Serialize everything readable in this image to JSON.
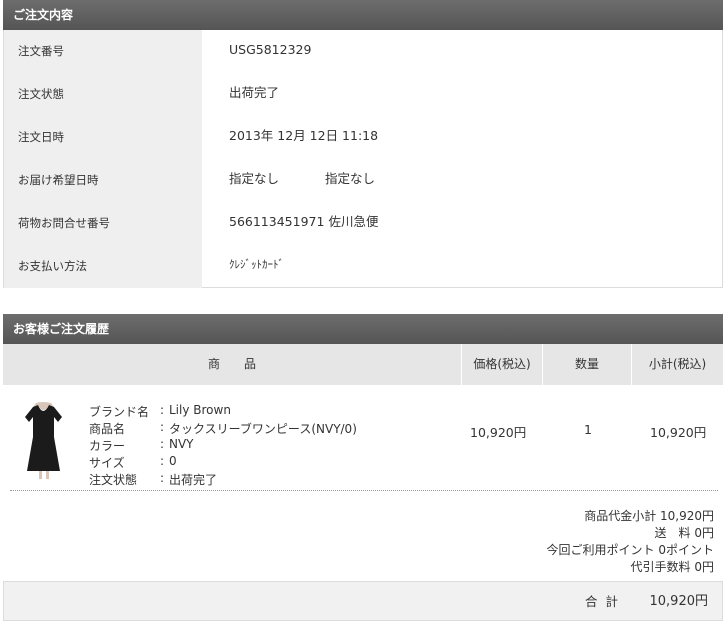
{
  "order_section": {
    "title": "ご注文内容",
    "rows": [
      {
        "label": "注文番号",
        "value": "USG5812329"
      },
      {
        "label": "注文状態",
        "value": "出荷完了"
      },
      {
        "label": "注文日時",
        "value": "2013年 12月 12日 11:18"
      },
      {
        "label": "お届け希望日時",
        "value": "指定なし",
        "value2": "指定なし"
      },
      {
        "label": "荷物お問合せ番号",
        "value": "566113451971",
        "value2": "佐川急便"
      },
      {
        "label": "お支払い方法",
        "value": "ｸﾚｼﾞｯﾄｶｰﾄﾞ"
      }
    ]
  },
  "history_section": {
    "title": "お客様ご注文履歴",
    "columns": [
      "商　　品",
      "価格(税込)",
      "数量",
      "小計(税込)"
    ],
    "item": {
      "image_icon": "black-dress-image",
      "attributes": [
        {
          "label": "ブランド名",
          "value": "Lily Brown"
        },
        {
          "label": "商品名",
          "value": "タックスリーブワンピース(NVY/0)"
        },
        {
          "label": "カラー",
          "value": "NVY"
        },
        {
          "label": "サイズ",
          "value": "0"
        },
        {
          "label": "注文状態",
          "value": "出荷完了"
        }
      ],
      "colon": ":",
      "price": "10,920円",
      "quantity": "1",
      "subtotal": "10,920円"
    },
    "summary": [
      "商品代金小計 10,920円",
      "送　料 0円",
      "今回ご利用ポイント 0ポイント",
      "代引手数料 0円"
    ],
    "total_label": "合計",
    "total_value": "10,920円"
  },
  "colors": {
    "header_bg": "#5f5f5f",
    "label_bg": "#efefef",
    "column_header_bg": "#e6e6e6"
  }
}
